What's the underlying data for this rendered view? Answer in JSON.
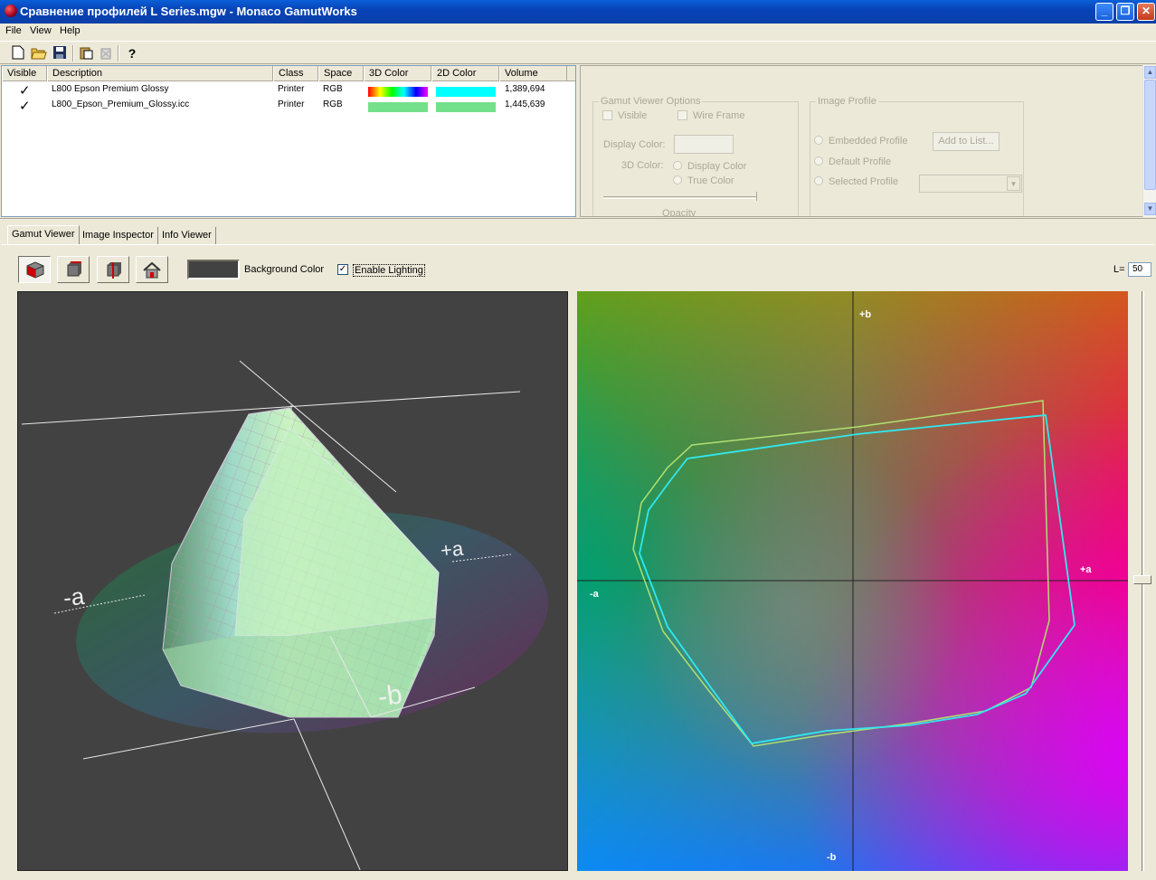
{
  "window": {
    "title": "Сравнение профилей L Series.mgw - Monaco GamutWorks",
    "minimize": "_",
    "maximize": "❐",
    "close": "✕"
  },
  "menu": [
    "File",
    "View",
    "Help"
  ],
  "toolbar_icons": [
    "new-icon",
    "open-icon",
    "save-icon",
    "paste-icon",
    "delete-icon",
    "help-icon"
  ],
  "profiles": {
    "columns": [
      "Visible",
      "Description",
      "Class",
      "Space",
      "3D Color",
      "2D Color",
      "Volume"
    ],
    "rows": [
      {
        "visible": "✓",
        "description": "L800 Epson Premium Glossy",
        "class": "Printer",
        "space": "RGB",
        "color3d": "rainbow",
        "color2d": "#00ffff",
        "volume": "1,389,694"
      },
      {
        "visible": "✓",
        "description": "L800_Epson_Premium_Glossy.icc",
        "class": "Printer",
        "space": "RGB",
        "color3d": "#74e08c",
        "color2d": "#74e08c",
        "volume": "1,445,639"
      }
    ]
  },
  "options": {
    "gamut_group": "Gamut Viewer Options",
    "visible": "Visible",
    "wire_frame": "Wire Frame",
    "display_color": "Display Color:",
    "color_3d": "3D Color:",
    "display_color_opt": "Display Color",
    "true_color_opt": "True Color",
    "opacity": "Opacity",
    "image_group": "Image Profile",
    "embedded": "Embedded Profile",
    "default": "Default Profile",
    "selected": "Selected Profile",
    "add_to_list": "Add to List..."
  },
  "tabs": [
    "Gamut Viewer",
    "Image Inspector",
    "Info Viewer"
  ],
  "viewer_toolbar": {
    "buttons": [
      "view-3d-icon",
      "view-top-icon",
      "view-side-icon",
      "home-view-icon"
    ],
    "background_color_label": "Background Color",
    "background_color": "#424242",
    "enable_lighting": "Enable Lighting",
    "enable_lighting_checked": true,
    "l_label": "L=",
    "l_value": "50"
  },
  "view3d_labels": {
    "minus_a": "-a",
    "plus_a": "+a",
    "minus_b": "-b"
  },
  "view2d_labels": {
    "plus_b": "+b",
    "minus_b": "-b",
    "plus_a": "+a",
    "minus_a": "-a"
  },
  "colors": {
    "titlebar": "#0a5fd8",
    "chrome": "#ece9d8",
    "gamut1": "#00ffff",
    "gamut2": "#a8e07c"
  }
}
